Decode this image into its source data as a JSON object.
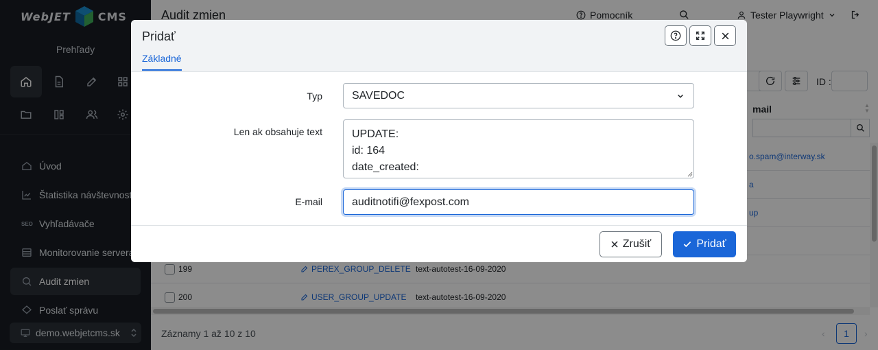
{
  "sidebar": {
    "logo_left": "WebJET",
    "logo_right": "CMS",
    "section_title": "Prehľady",
    "icon_grid": [
      "home-icon",
      "document-icon",
      "edit-icon",
      "apps-icon",
      "folder-icon",
      "layout-icon",
      "users-icon",
      "gear-icon"
    ],
    "items": [
      {
        "label": "Úvod",
        "icon": "home-icon"
      },
      {
        "label": "Štatistika návštevnosti",
        "icon": "chart-icon"
      },
      {
        "label": "Vyhľadávače",
        "icon": "seo-icon"
      },
      {
        "label": "Monitorovanie servera",
        "icon": "monitor-icon"
      },
      {
        "label": "Audit zmien",
        "icon": "audit-icon"
      },
      {
        "label": "Poslať správu",
        "icon": "message-icon"
      }
    ],
    "domain": "demo.webjetcms.sk"
  },
  "header": {
    "page_title": "Audit zmien",
    "help": "Pomocník",
    "user": "Tester Playwright"
  },
  "table": {
    "id_label": "ID :",
    "email_column": "mail",
    "rows": [
      {
        "email_fragment": "o.spam@interway.sk"
      },
      {
        "email_fragment": "a"
      },
      {
        "email_fragment": "up"
      }
    ],
    "visible_rows": [
      {
        "id": "199",
        "type": "PEREX_GROUP_DELETE",
        "text": "text-autotest-16-09-2020"
      },
      {
        "id": "200",
        "type": "USER_GROUP_UPDATE",
        "text": "text-autotest-16-09-2020"
      }
    ],
    "footer_info": "Záznamy 1 až 10 z 10",
    "current_page": "1"
  },
  "modal": {
    "title": "Pridať",
    "tab": "Základné",
    "fields": {
      "type_label": "Typ",
      "type_value": "SAVEDOC",
      "text_label": "Len ak obsahuje text",
      "text_value": "UPDATE:\nid: 164\ndate_created:",
      "email_label": "E-mail",
      "email_value": "auditnotifi@fexpost.com"
    },
    "cancel_label": "Zrušiť",
    "submit_label": "Pridať"
  },
  "colors": {
    "accent": "#1a66d8",
    "sidebar_bg": "#181d23"
  }
}
